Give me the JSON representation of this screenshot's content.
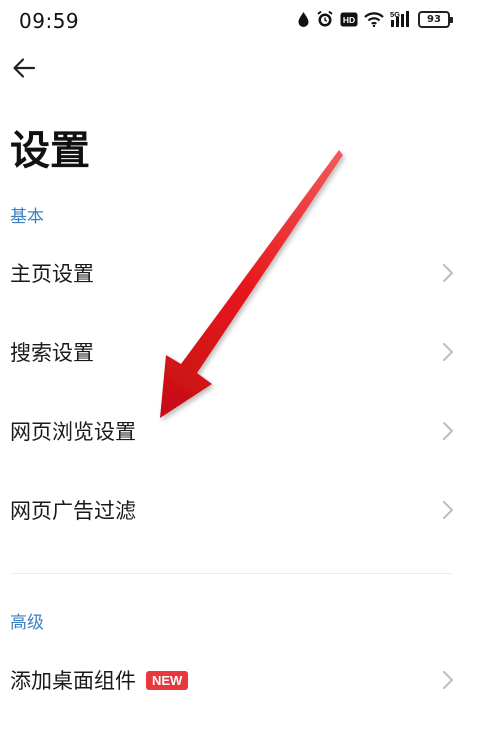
{
  "status_bar": {
    "time": "09:59",
    "battery": "93",
    "icons": [
      "water-drop-icon",
      "alarm-icon",
      "hd-icon",
      "wifi-icon",
      "signal-5g-icon",
      "battery-icon"
    ]
  },
  "header": {
    "back_icon": "arrow-left-icon",
    "title": "设置"
  },
  "sections": [
    {
      "label": "基本",
      "items": [
        {
          "label": "主页设置"
        },
        {
          "label": "搜索设置"
        },
        {
          "label": "网页浏览设置"
        },
        {
          "label": "网页广告过滤"
        }
      ]
    },
    {
      "label": "高级",
      "items": [
        {
          "label": "添加桌面组件",
          "badge": "NEW"
        }
      ]
    }
  ],
  "colors": {
    "section_label": "#3c7fc6",
    "badge_bg": "#e8383c",
    "annotation_arrow": "#e8191d"
  }
}
